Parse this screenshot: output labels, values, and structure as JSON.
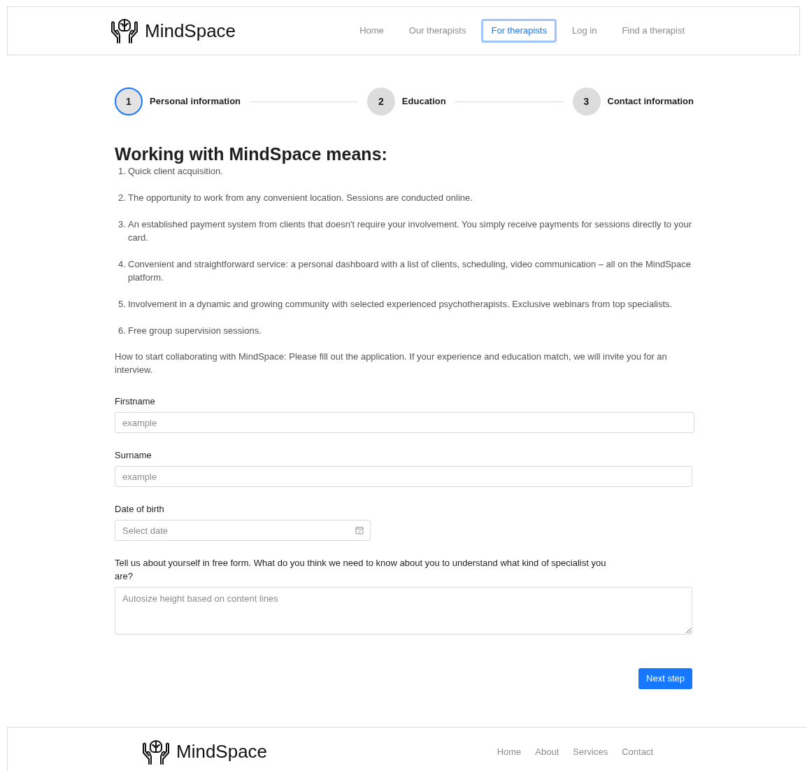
{
  "header": {
    "logo": "MindSpace",
    "nav": [
      {
        "label": "Home",
        "selected": false
      },
      {
        "label": "Our therapists",
        "selected": false
      },
      {
        "label": "For therapists",
        "selected": true
      },
      {
        "label": "Log in",
        "selected": false
      },
      {
        "label": "Find a therapist",
        "selected": false
      }
    ]
  },
  "steps": [
    {
      "number": "1",
      "label": "Personal information",
      "selected": true
    },
    {
      "number": "2",
      "label": "Education",
      "selected": false
    },
    {
      "number": "3",
      "label": "Contact information",
      "selected": false
    }
  ],
  "heading": "Working with MindSpace means:",
  "benefits": [
    {
      "number": "1.",
      "text": "Quick client acquisition."
    },
    {
      "number": "2.",
      "text": "The opportunity to work from any convenient location. Sessions are conducted online."
    },
    {
      "number": "3.",
      "text": "An established payment system from clients that doesn't require your involvement. You simply receive payments for sessions directly to your card."
    },
    {
      "number": "4.",
      "text": "Convenient and straightforward service: a personal dashboard with a list of clients, scheduling, video communication – all on the MindSpace platform."
    },
    {
      "number": "5.",
      "text": "Involvement in a dynamic and growing community with selected experienced psychotherapists. Exclusive webinars from top specialists."
    },
    {
      "number": "6.",
      "text": "Free group supervision sessions."
    }
  ],
  "intro": "How to start collaborating with MindSpace: Please fill out the application. If your experience and education match, we will invite you for an interview.",
  "form": {
    "fields": [
      {
        "kind": "text",
        "label": "Firstname",
        "placeholder": "example"
      },
      {
        "kind": "text",
        "label": "Surname",
        "placeholder": "example"
      },
      {
        "kind": "date",
        "label": "Date of birth",
        "placeholder": "Select date"
      },
      {
        "kind": "textarea",
        "label": "Tell us about yourself in free form. What do you think we need to know about you to understand what kind of specialist you are?",
        "placeholder": "Autosize height based on content lines"
      }
    ],
    "submit": "Next step"
  },
  "footer": {
    "logo": "MindSpace",
    "nav": [
      "Home",
      "About",
      "Services",
      "Contact"
    ]
  }
}
